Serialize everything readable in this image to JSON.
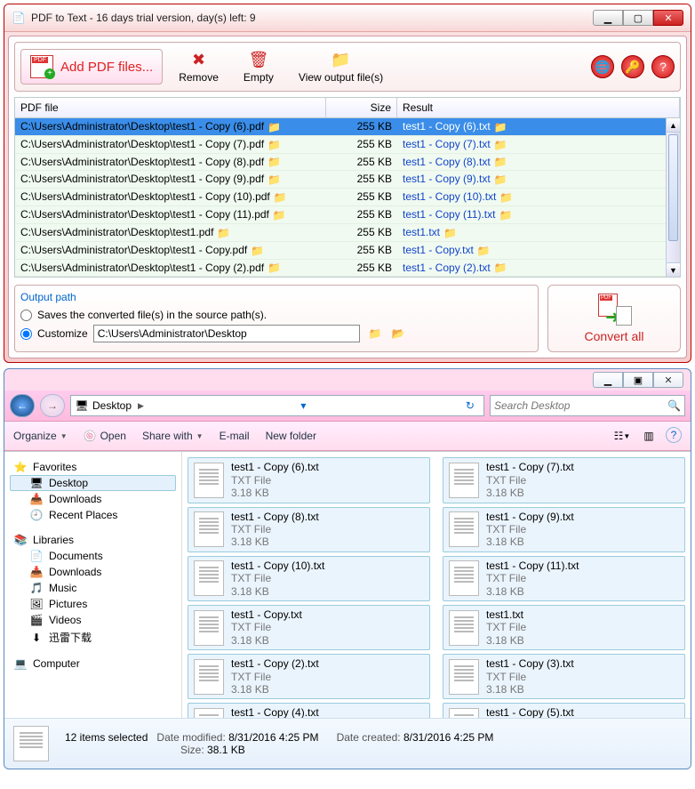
{
  "win1": {
    "title": "PDF to Text - 16 days trial version, day(s) left: 9",
    "add_pdf_label": "Add PDF files...",
    "remove_label": "Remove",
    "empty_label": "Empty",
    "view_output_label": "View output file(s)",
    "col_file": "PDF file",
    "col_size": "Size",
    "col_result": "Result",
    "rows": [
      {
        "file": "C:\\Users\\Administrator\\Desktop\\test1 - Copy (6).pdf",
        "size": "255 KB",
        "result": "test1 - Copy (6).txt",
        "sel": true
      },
      {
        "file": "C:\\Users\\Administrator\\Desktop\\test1 - Copy (7).pdf",
        "size": "255 KB",
        "result": "test1 - Copy (7).txt"
      },
      {
        "file": "C:\\Users\\Administrator\\Desktop\\test1 - Copy (8).pdf",
        "size": "255 KB",
        "result": "test1 - Copy (8).txt"
      },
      {
        "file": "C:\\Users\\Administrator\\Desktop\\test1 - Copy (9).pdf",
        "size": "255 KB",
        "result": "test1 - Copy (9).txt"
      },
      {
        "file": "C:\\Users\\Administrator\\Desktop\\test1 - Copy (10).pdf",
        "size": "255 KB",
        "result": "test1 - Copy (10).txt"
      },
      {
        "file": "C:\\Users\\Administrator\\Desktop\\test1 - Copy (11).pdf",
        "size": "255 KB",
        "result": "test1 - Copy (11).txt"
      },
      {
        "file": "C:\\Users\\Administrator\\Desktop\\test1.pdf",
        "size": "255 KB",
        "result": "test1.txt"
      },
      {
        "file": "C:\\Users\\Administrator\\Desktop\\test1 - Copy.pdf",
        "size": "255 KB",
        "result": "test1 - Copy.txt"
      },
      {
        "file": "C:\\Users\\Administrator\\Desktop\\test1 - Copy (2).pdf",
        "size": "255 KB",
        "result": "test1 - Copy (2).txt"
      }
    ],
    "output_path_label": "Output path",
    "save_source_label": "Saves the converted file(s) in the source path(s).",
    "customize_label": "Customize",
    "custom_path_value": "C:\\Users\\Administrator\\Desktop",
    "convert_label": "Convert all"
  },
  "win2": {
    "breadcrumb_root": "Desktop",
    "search_placeholder": "Search Desktop",
    "cmd_organize": "Organize",
    "cmd_open": "Open",
    "cmd_share": "Share with",
    "cmd_email": "E-mail",
    "cmd_newfolder": "New folder",
    "sidebar": {
      "favorites": "Favorites",
      "desktop": "Desktop",
      "downloads": "Downloads",
      "recent": "Recent Places",
      "libraries": "Libraries",
      "documents": "Documents",
      "downloads2": "Downloads",
      "music": "Music",
      "pictures": "Pictures",
      "videos": "Videos",
      "xunlei": "迅雷下载",
      "computer": "Computer"
    },
    "file_type": "TXT File",
    "file_size": "3.18 KB",
    "files_left": [
      "test1 - Copy (6).txt",
      "test1 - Copy (8).txt",
      "test1 - Copy (10).txt",
      "test1 - Copy.txt",
      "test1 - Copy (2).txt",
      "test1 - Copy (4).txt"
    ],
    "files_right": [
      "test1 - Copy (7).txt",
      "test1 - Copy (9).txt",
      "test1 - Copy (11).txt",
      "test1.txt",
      "test1 - Copy (3).txt",
      "test1 - Copy (5).txt"
    ],
    "status": {
      "sel_count": "12 items selected",
      "mod_label": "Date modified:",
      "mod_val": "8/31/2016 4:25 PM",
      "created_label": "Date created:",
      "created_val": "8/31/2016 4:25 PM",
      "size_label": "Size:",
      "size_val": "38.1 KB"
    }
  }
}
